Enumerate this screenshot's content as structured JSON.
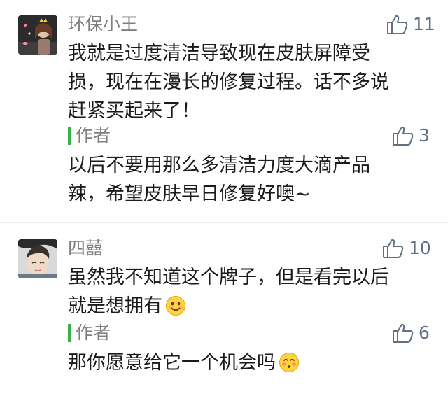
{
  "comments": [
    {
      "nickname": "环保小王",
      "likes": "11",
      "content_lines": [
        "我就是过度清洁导致现在皮肤屏障受",
        "损，现在在漫长的修复过程。话不多说",
        "赶紧买起来了！"
      ],
      "reply": {
        "author": "作者",
        "likes": "3",
        "content_lines": [
          "以后不要用那么多清洁力度大滴产品",
          "辣，希望皮肤早日修复好噢~"
        ]
      }
    },
    {
      "nickname": "四囍",
      "likes": "10",
      "content_lines": [
        "虽然我不知道这个牌子，但是看完以后",
        "就是想拥有"
      ],
      "content_emoji": "smiling-face",
      "reply": {
        "author": "作者",
        "likes": "6",
        "content_lines": [
          "那你愿意给它一个机会吗"
        ],
        "content_emoji": "blushing-face"
      }
    }
  ],
  "colors": {
    "reply_bar": "#36b24a",
    "like_icon": "#5f6f84",
    "nickname": "#7f7f7f",
    "text": "#1a1a1a"
  },
  "icons": {
    "like": "thumbs-up-outline-icon"
  }
}
